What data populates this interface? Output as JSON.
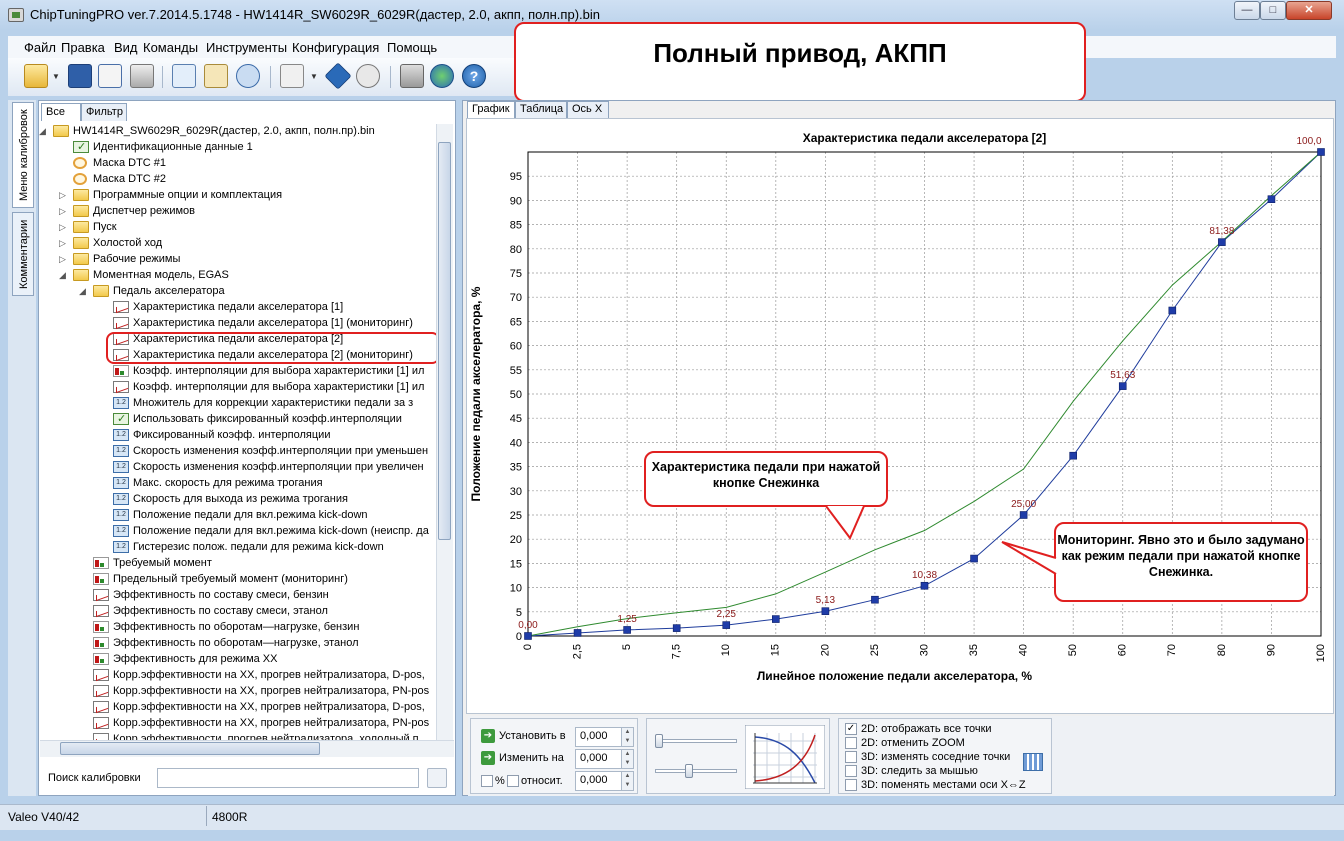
{
  "window": {
    "title": "ChipTuningPRO ver.7.2014.5.1748 - HW1414R_SW6029R_6029R(дастер, 2.0, акпп, полн.пр).bin",
    "min": "—",
    "max": "□",
    "close": "✕"
  },
  "menu": [
    "Файл",
    "Правка",
    "Вид",
    "Команды",
    "Инструменты",
    "Конфигурация",
    "Помощь"
  ],
  "toolbar_icons": [
    "open-folder-icon",
    "save-icon",
    "edit-icon",
    "print-icon",
    "copy-icon",
    "paste-icon",
    "undo-icon",
    "compare-icon",
    "info-icon",
    "checksum-icon",
    "tools-icon",
    "web-icon",
    "help-icon"
  ],
  "annotation_main": "Полный привод, АКПП",
  "side_tabs": {
    "calibrations": "Меню калибровок",
    "comments": "Комментарии"
  },
  "tree_tabs": {
    "all": "Все",
    "filter": "Фильтр"
  },
  "tree": [
    {
      "label": "HW1414R_SW6029R_6029R(дастер, 2.0, акпп, полн.пр).bin",
      "icon": "folder",
      "exp": "◢"
    },
    {
      "label": "Идентификационные данные 1",
      "icon": "chk"
    },
    {
      "label": "Маска DTC #1",
      "icon": "mask"
    },
    {
      "label": "Маска DTC #2",
      "icon": "mask"
    },
    {
      "label": "Программные опции и комплектация",
      "icon": "folder",
      "exp": "▷"
    },
    {
      "label": "Диспетчер режимов",
      "icon": "folder",
      "exp": "▷"
    },
    {
      "label": "Пуск",
      "icon": "folder",
      "exp": "▷"
    },
    {
      "label": "Холостой ход",
      "icon": "folder",
      "exp": "▷"
    },
    {
      "label": "Рабочие режимы",
      "icon": "folder",
      "exp": "▷"
    },
    {
      "label": "Моментная модель, EGAS",
      "icon": "folder",
      "exp": "◢"
    },
    {
      "label": "Педаль акселератора",
      "icon": "folder",
      "exp": "◢"
    },
    {
      "label": "Характеристика педали акселератора [1]",
      "icon": "data"
    },
    {
      "label": "Характеристика педали акселератора [1] (мониторинг)",
      "icon": "data"
    },
    {
      "label": "Характеристика педали акселератора [2]",
      "icon": "data"
    },
    {
      "label": "Характеристика педали акселератора [2] (мониторинг)",
      "icon": "data"
    },
    {
      "label": "Коэфф. интерполяции для выбора характеристики [1] ил",
      "icon": "curve"
    },
    {
      "label": "Коэфф. интерполяции для выбора характеристики [1] ил",
      "icon": "data"
    },
    {
      "label": "Множитель для коррекции характеристики педали за з",
      "icon": "num"
    },
    {
      "label": "Использовать фиксированный коэфф.интерполяции",
      "icon": "chk"
    },
    {
      "label": "Фиксированный коэфф. интерполяции",
      "icon": "num"
    },
    {
      "label": "Скорость изменения коэфф.интерполяции при уменьшен",
      "icon": "num"
    },
    {
      "label": "Скорость изменения коэфф.интерполяции при увеличен",
      "icon": "num"
    },
    {
      "label": "Макс. скорость для режима трогания",
      "icon": "num"
    },
    {
      "label": "Скорость для выхода из режима трогания",
      "icon": "num"
    },
    {
      "label": "Положение педали для вкл.режима kick-down",
      "icon": "num"
    },
    {
      "label": "Положение педали для вкл.режима kick-down (неиспр. да",
      "icon": "num"
    },
    {
      "label": "Гистерезис полож. педали для режима kick-down",
      "icon": "num"
    },
    {
      "label": "Требуемый момент",
      "icon": "curve"
    },
    {
      "label": "Предельный требуемый момент (мониторинг)",
      "icon": "curve"
    },
    {
      "label": "Эффективность по составу смеси, бензин",
      "icon": "data"
    },
    {
      "label": "Эффективность по составу смеси, этанол",
      "icon": "data"
    },
    {
      "label": "Эффективность по оборотам—нагрузке, бензин",
      "icon": "curve"
    },
    {
      "label": "Эффективность по оборотам—нагрузке, этанол",
      "icon": "curve"
    },
    {
      "label": "Эффективность для режима XX",
      "icon": "curve"
    },
    {
      "label": "Корр.эффективности на XX, прогрев нейтрализатора, D-pos,",
      "icon": "data"
    },
    {
      "label": "Корр.эффективности на XX, прогрев нейтрализатора, PN-pos",
      "icon": "data"
    },
    {
      "label": "Корр.эффективности на XX, прогрев нейтрализатора, D-pos,",
      "icon": "data"
    },
    {
      "label": "Корр.эффективности на XX, прогрев нейтрализатора, PN-pos",
      "icon": "data"
    },
    {
      "label": "Корр.эффективности, прогрев нейтрализатора, холодный п",
      "icon": "data"
    }
  ],
  "search": {
    "label": "Поиск калибровки",
    "value": ""
  },
  "view_tabs": [
    "График",
    "Таблица",
    "Ось X"
  ],
  "chart_data": {
    "type": "line",
    "title": "Характеристика педали акселератора [2]",
    "xlabel": "Линейное положение педали акселератора, %",
    "ylabel": "Положение педали акселератора, %",
    "x": [
      0,
      2.5,
      5,
      7.5,
      10,
      15,
      20,
      25,
      30,
      35,
      40,
      50,
      60,
      70,
      80,
      90,
      100
    ],
    "x_tick_labels": [
      "0",
      "2,5",
      "5",
      "7,5",
      "10",
      "15",
      "20",
      "25",
      "30",
      "35",
      "40",
      "50",
      "60",
      "70",
      "80",
      "90",
      "100"
    ],
    "ylim": [
      0,
      100
    ],
    "y_ticks": [
      0,
      5,
      10,
      15,
      20,
      25,
      30,
      35,
      40,
      45,
      50,
      55,
      60,
      65,
      70,
      75,
      80,
      85,
      90,
      95
    ],
    "grid": true,
    "series": [
      {
        "values": [
          0,
          0.63,
          1.25,
          1.63,
          2.25,
          3.5,
          5.13,
          7.5,
          10.38,
          16,
          25,
          37.25,
          51.63,
          67.25,
          81.38,
          90.25,
          100
        ],
        "color": "#1f3c9c"
      },
      {
        "values": [
          0,
          1.9,
          3.6,
          4.8,
          5.9,
          8.7,
          13.2,
          17.8,
          21.8,
          27.8,
          34.5,
          48.5,
          61,
          72.5,
          81.5,
          91,
          100
        ],
        "color": "#2f8a2f"
      }
    ],
    "data_labels": [
      {
        "x": 0,
        "text": "0,00"
      },
      {
        "x": 5,
        "text": "1,25"
      },
      {
        "x": 10,
        "text": "2,25"
      },
      {
        "x": 20,
        "text": "5,13"
      },
      {
        "x": 30,
        "text": "10,38"
      },
      {
        "x": 40,
        "text": "25,00"
      },
      {
        "x": 60,
        "text": "51,63"
      },
      {
        "x": 80,
        "text": "81,38"
      },
      {
        "x": 100,
        "text": "100,0"
      }
    ]
  },
  "callouts": {
    "snowflake": "Характеристика педали при нажатой кнопке Снежинка",
    "monitoring": "Мониторинг. Явно это и было задумано как режим педали при нажатой кнопке Снежинка."
  },
  "controls": {
    "set_label": "Установить в",
    "set_value": "0,000",
    "change_label": "Изменить на",
    "change_value": "0,000",
    "percent_label": "%",
    "relative_label": "относит.",
    "relative_value": "0,000",
    "options": [
      {
        "label": "2D: отображать все точки",
        "checked": true
      },
      {
        "label": "2D: отменить ZOOM",
        "checked": false
      },
      {
        "label": "3D: изменять соседние точки",
        "checked": false
      },
      {
        "label": "3D: следить за мышью",
        "checked": false
      },
      {
        "label": "3D: поменять местами оси X⇔Z",
        "checked": false
      }
    ]
  },
  "status": {
    "ecu": "Valeo V40/42",
    "hw": "4800R"
  }
}
